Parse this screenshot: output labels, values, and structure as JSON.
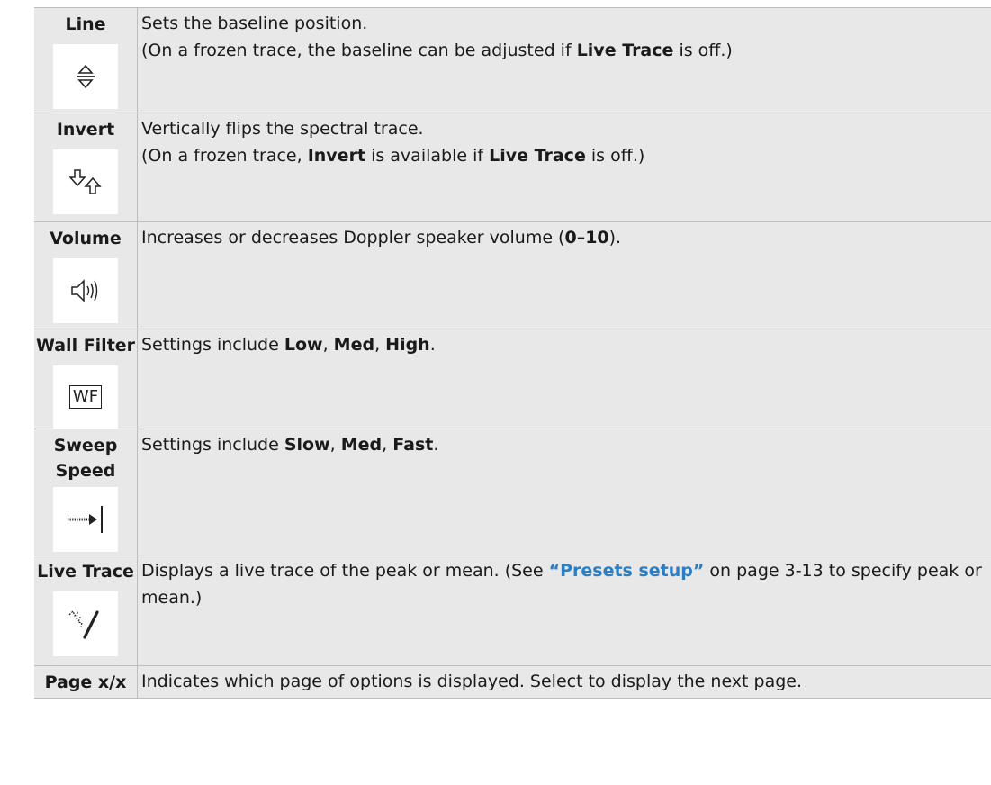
{
  "rows": [
    {
      "label": "Line",
      "icon": "baseline-icon",
      "line1": "Sets the baseline position.",
      "line2_parts": [
        "(On a frozen trace, the baseline can be adjusted if ",
        "Live Trace",
        " is off.)"
      ]
    },
    {
      "label": "Invert",
      "icon": "invert-arrows-icon",
      "line1": "Vertically flips the spectral trace.",
      "line2_parts": [
        "(On a frozen trace, ",
        "Invert",
        " is available if ",
        "Live Trace",
        " is off.)"
      ]
    },
    {
      "label": "Volume",
      "icon": "speaker-volume-icon",
      "parts": [
        "Increases or decreases Doppler speaker volume (",
        "0–10",
        ")."
      ]
    },
    {
      "label": "Wall Filter",
      "icon": "wall-filter-icon",
      "icon_text": "WF",
      "parts": [
        "Settings include ",
        "Low",
        ", ",
        "Med",
        ", ",
        "High",
        "."
      ]
    },
    {
      "label_line1": "Sweep",
      "label_line2": "Speed",
      "icon": "sweep-speed-icon",
      "parts": [
        "Settings include ",
        "Slow",
        ", ",
        "Med",
        ", ",
        "Fast",
        "."
      ]
    },
    {
      "label": "Live Trace",
      "icon": "live-trace-icon",
      "parts": [
        "Displays a live trace of the peak or mean. (See ",
        "“Presets setup”",
        " on page 3-13 to specify peak or mean.)"
      ]
    },
    {
      "label": "Page x/x",
      "text": "Indicates which page of options is displayed. Select to display the next page."
    }
  ]
}
